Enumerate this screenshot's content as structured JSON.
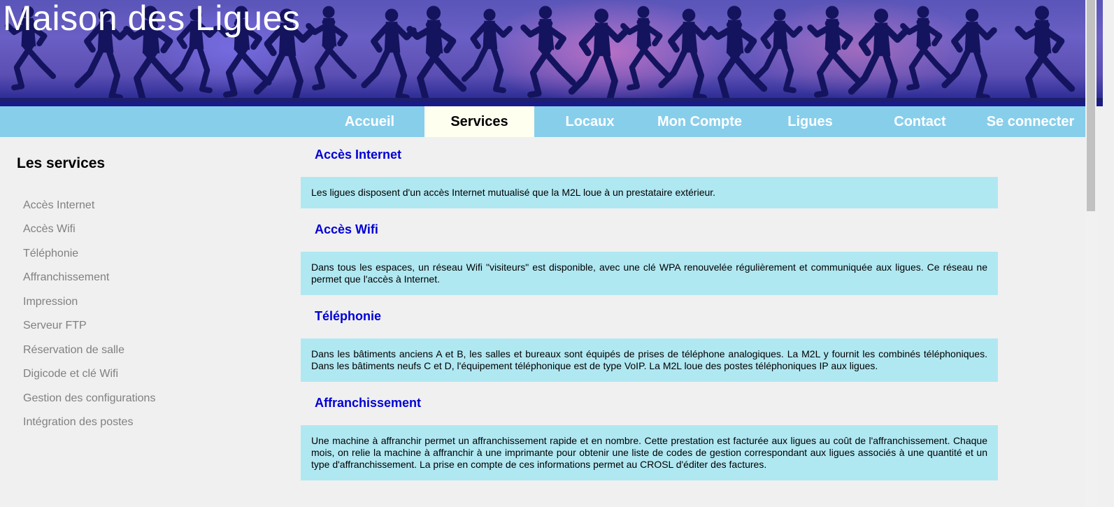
{
  "header": {
    "title": "Maison des Ligues",
    "banner_colors": {
      "sky_top": "#5a55b8",
      "sky_bottom": "#15157a",
      "silhouette": "#14145e"
    }
  },
  "nav": {
    "items": [
      {
        "label": "Accueil"
      },
      {
        "label": "Services",
        "active": true
      },
      {
        "label": "Locaux"
      },
      {
        "label": "Mon Compte"
      },
      {
        "label": "Ligues"
      },
      {
        "label": "Contact"
      },
      {
        "label": "Se connecter"
      }
    ],
    "colors": {
      "bar": "#87ceeb",
      "active_bg": "#fffff0"
    }
  },
  "sidebar": {
    "title": "Les services",
    "links": [
      "Accès Internet",
      "Accès Wifi",
      "Téléphonie",
      "Affranchissement",
      "Impression",
      "Serveur FTP",
      "Réservation de salle",
      "Digicode et clé Wifi",
      "Gestion des configurations",
      "Intégration des postes"
    ]
  },
  "main": {
    "sections": [
      {
        "title": "Accès Internet",
        "text": "Les ligues disposent d'un accès Internet mutualisé que la M2L loue à un prestataire extérieur."
      },
      {
        "title": "Accès Wifi",
        "text": "Dans tous les espaces, un réseau Wifi \"visiteurs\" est disponible, avec une clé WPA renouvelée régulièrement et communiquée aux ligues. Ce réseau ne permet que l'accès à Internet."
      },
      {
        "title": "Téléphonie",
        "text": "Dans les bâtiments anciens A et B, les salles et bureaux sont équipés de prises de téléphone analogiques. La M2L y fournit les combinés téléphoniques. Dans les bâtiments neufs C et D, l'équipement téléphonique est de type VoIP. La M2L loue des postes téléphoniques IP aux ligues."
      },
      {
        "title": "Affranchissement",
        "text": "Une machine à affranchir permet un affranchissement rapide et en nombre. Cette prestation est facturée aux ligues au coût de l'affranchissement. Chaque mois, on relie la machine à affranchir à une imprimante pour obtenir une liste de codes de gestion correspondant aux ligues associés à une quantité et un type d'affranchissement. La prise en compte de ces informations permet au CROSL d'éditer des factures."
      }
    ],
    "colors": {
      "title": "#0000d6",
      "box_bg": "#b0e8f2"
    }
  }
}
